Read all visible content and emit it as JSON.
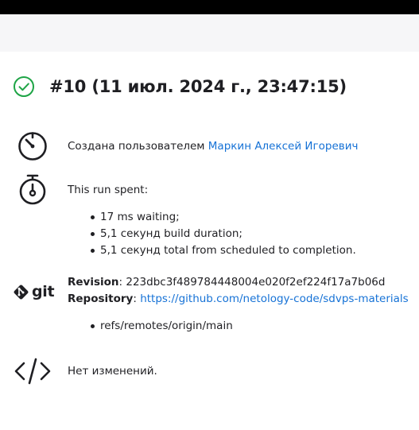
{
  "header": {
    "title": "#10 (11 июл. 2024 г., 23:47:15)",
    "status_icon": "check-circle-icon",
    "status_color": "#1ea446"
  },
  "started_by": {
    "icon": "timer-icon",
    "prefix": "Создана пользователем ",
    "user": "Маркин Алексей Игоревич"
  },
  "timing": {
    "icon": "stopwatch-icon",
    "summary": "This run spent:",
    "items": [
      "17 ms waiting;",
      "5,1 секунд build duration;",
      "5,1 секунд total from scheduled to completion."
    ]
  },
  "scm": {
    "logo_text": "git",
    "revision_label": "Revision",
    "revision_value": ": 223dbc3f489784448004e020f2ef224f17a7b06d",
    "repository_label": "Repository",
    "repository_sep": ": ",
    "repository_url": "https://github.com/netology-code/sdvps-materials",
    "branches": [
      "refs/remotes/origin/main"
    ]
  },
  "changes": {
    "icon": "code-icon",
    "text": "Нет изменений."
  },
  "colors": {
    "link": "#1672d6",
    "git_diamond": "#1f1f23"
  }
}
